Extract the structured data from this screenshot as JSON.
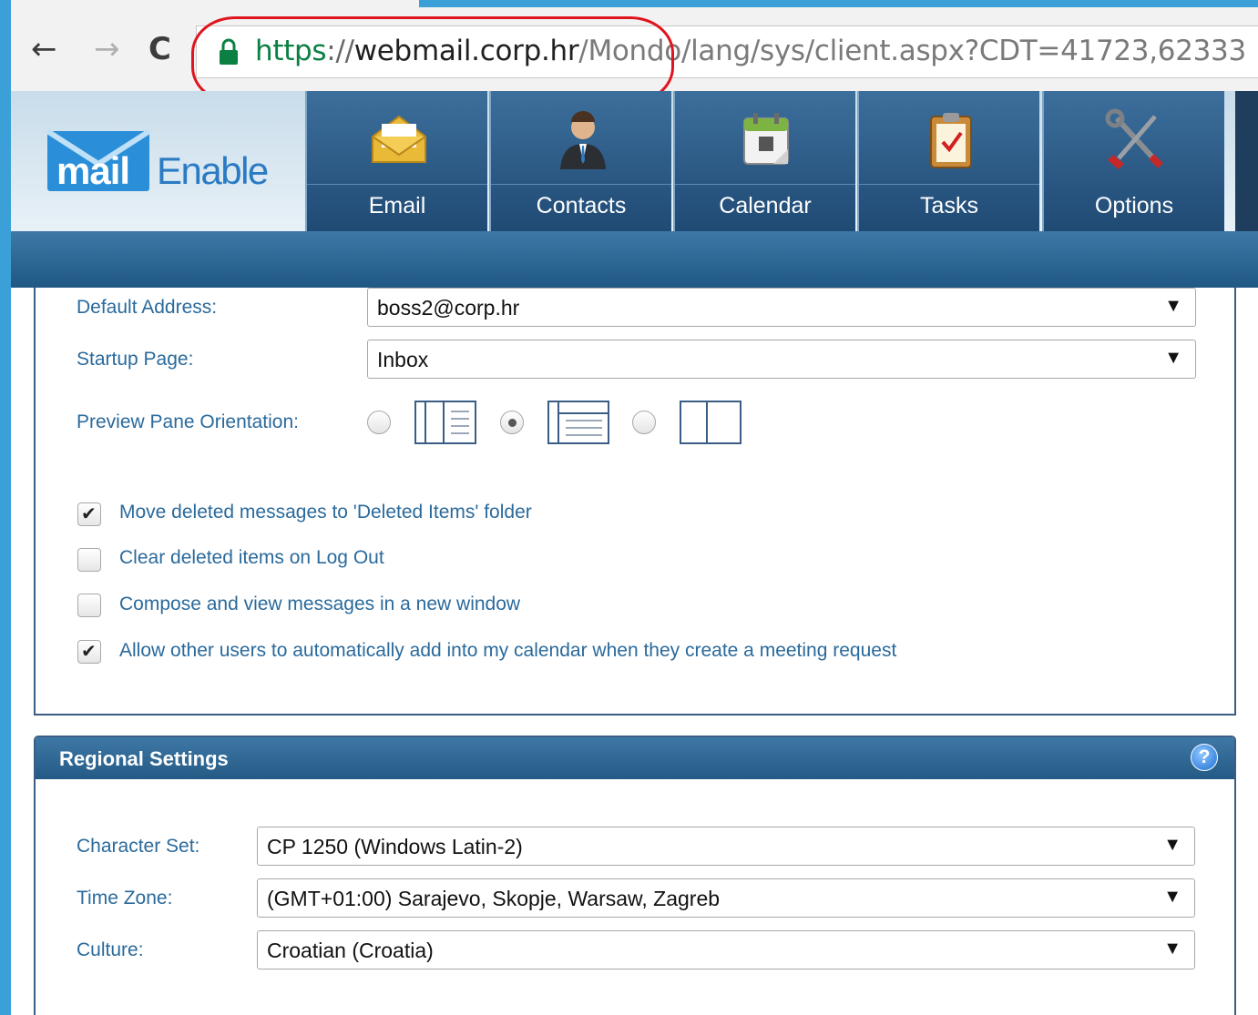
{
  "browser": {
    "url_scheme": "https",
    "url_sep": "://",
    "url_host": "webmail.corp.hr",
    "url_path": "/Mondo/lang/sys/client.aspx?CDT=41723,62333"
  },
  "app": {
    "logo_mail": "mail",
    "logo_enable": "Enable",
    "nav": [
      {
        "label": "Email",
        "icon": "envelope-icon"
      },
      {
        "label": "Contacts",
        "icon": "person-icon"
      },
      {
        "label": "Calendar",
        "icon": "calendar-icon"
      },
      {
        "label": "Tasks",
        "icon": "clipboard-icon"
      },
      {
        "label": "Options",
        "icon": "tools-icon"
      }
    ],
    "active_tab": "Options"
  },
  "general": {
    "default_address_label": "Default Address:",
    "default_address_value": "boss2@corp.hr",
    "startup_page_label": "Startup Page:",
    "startup_page_value": "Inbox",
    "preview_pane_label": "Preview Pane Orientation:",
    "preview_pane_options": [
      "vertical",
      "horizontal",
      "none"
    ],
    "preview_pane_selected": "horizontal",
    "checkboxes": [
      {
        "label": "Move deleted messages to 'Deleted Items' folder",
        "checked": true
      },
      {
        "label": "Clear deleted items on Log Out",
        "checked": false
      },
      {
        "label": "Compose and view messages in a new window",
        "checked": false
      },
      {
        "label": "Allow other users to automatically add into my calendar when they create a meeting request",
        "checked": true
      }
    ]
  },
  "regional": {
    "title": "Regional Settings",
    "help": "?",
    "character_set_label": "Character Set:",
    "character_set_value": "CP 1250 (Windows Latin-2)",
    "time_zone_label": "Time Zone:",
    "time_zone_value": "(GMT+01:00) Sarajevo, Skopje, Warsaw, Zagreb",
    "culture_label": "Culture:",
    "culture_value": "Croatian (Croatia)"
  },
  "colors": {
    "accent": "#2a6a9c",
    "header_blue": "#2f6391",
    "annotation_red": "#e0141e",
    "url_green": "#0b8043"
  }
}
